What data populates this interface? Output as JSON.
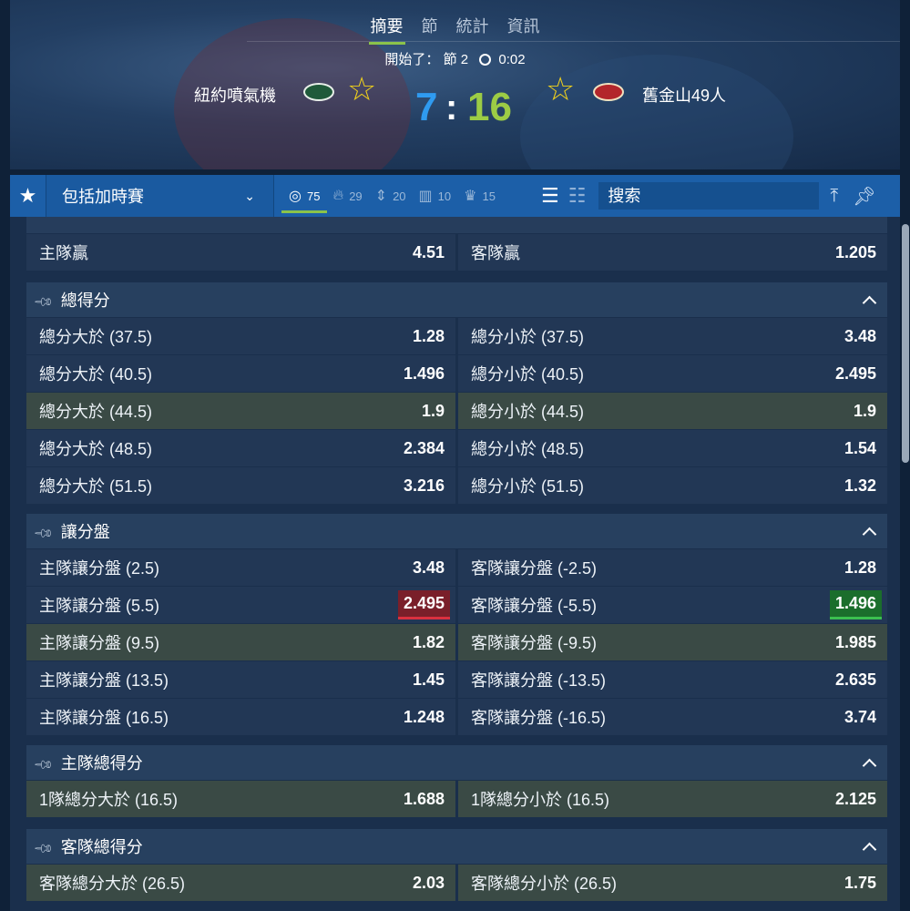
{
  "header": {
    "tabs": [
      {
        "label": "摘要"
      },
      {
        "label": "節"
      },
      {
        "label": "統計"
      },
      {
        "label": "資訊"
      }
    ],
    "status_prefix": "開始了：",
    "period": "節 2",
    "clock": "0:02",
    "home_team": "紐約噴氣機",
    "away_team": "舊金山49人",
    "home_score": "7",
    "separator": ":",
    "away_score": "16",
    "home_color": "#2f9bf0",
    "away_color": "#9ccc45"
  },
  "toolbar": {
    "select_label": "包括加時賽",
    "counts": [
      {
        "icon": "target-icon",
        "value": "75"
      },
      {
        "icon": "fire-icon",
        "value": "29"
      },
      {
        "icon": "updown-icon",
        "value": "20"
      },
      {
        "icon": "bars-icon",
        "value": "10"
      },
      {
        "icon": "trophy-icon",
        "value": "15"
      }
    ],
    "search_placeholder": "搜索"
  },
  "markets": {
    "top": {
      "home_label": "主隊贏",
      "home_odd": "4.51",
      "away_label": "客隊贏",
      "away_odd": "1.205"
    },
    "total": {
      "title": "總得分",
      "rows": [
        {
          "l": "總分大於 (37.5)",
          "lo": "1.28",
          "r": "總分小於 (37.5)",
          "ro": "3.48"
        },
        {
          "l": "總分大於 (40.5)",
          "lo": "1.496",
          "r": "總分小於 (40.5)",
          "ro": "2.495"
        },
        {
          "l": "總分大於 (44.5)",
          "lo": "1.9",
          "r": "總分小於 (44.5)",
          "ro": "1.9"
        },
        {
          "l": "總分大於 (48.5)",
          "lo": "2.384",
          "r": "總分小於 (48.5)",
          "ro": "1.54"
        },
        {
          "l": "總分大於 (51.5)",
          "lo": "3.216",
          "r": "總分小於 (51.5)",
          "ro": "1.32"
        }
      ]
    },
    "handicap": {
      "title": "讓分盤",
      "rows": [
        {
          "l": "主隊讓分盤 (2.5)",
          "lo": "3.48",
          "r": "客隊讓分盤 (-2.5)",
          "ro": "1.28"
        },
        {
          "l": "主隊讓分盤 (5.5)",
          "lo": "2.495",
          "r": "客隊讓分盤 (-5.5)",
          "ro": "1.496"
        },
        {
          "l": "主隊讓分盤 (9.5)",
          "lo": "1.82",
          "r": "客隊讓分盤 (-9.5)",
          "ro": "1.985"
        },
        {
          "l": "主隊讓分盤 (13.5)",
          "lo": "1.45",
          "r": "客隊讓分盤 (-13.5)",
          "ro": "2.635"
        },
        {
          "l": "主隊讓分盤 (16.5)",
          "lo": "1.248",
          "r": "客隊讓分盤 (-16.5)",
          "ro": "3.74"
        }
      ]
    },
    "home_total": {
      "title": "主隊總得分",
      "rows": [
        {
          "l": "1隊總分大於 (16.5)",
          "lo": "1.688",
          "r": "1隊總分小於 (16.5)",
          "ro": "2.125"
        }
      ]
    },
    "away_total": {
      "title": "客隊總得分",
      "rows": [
        {
          "l": "客隊總分大於 (26.5)",
          "lo": "2.03",
          "r": "客隊總分小於 (26.5)",
          "ro": "1.75"
        }
      ]
    }
  }
}
